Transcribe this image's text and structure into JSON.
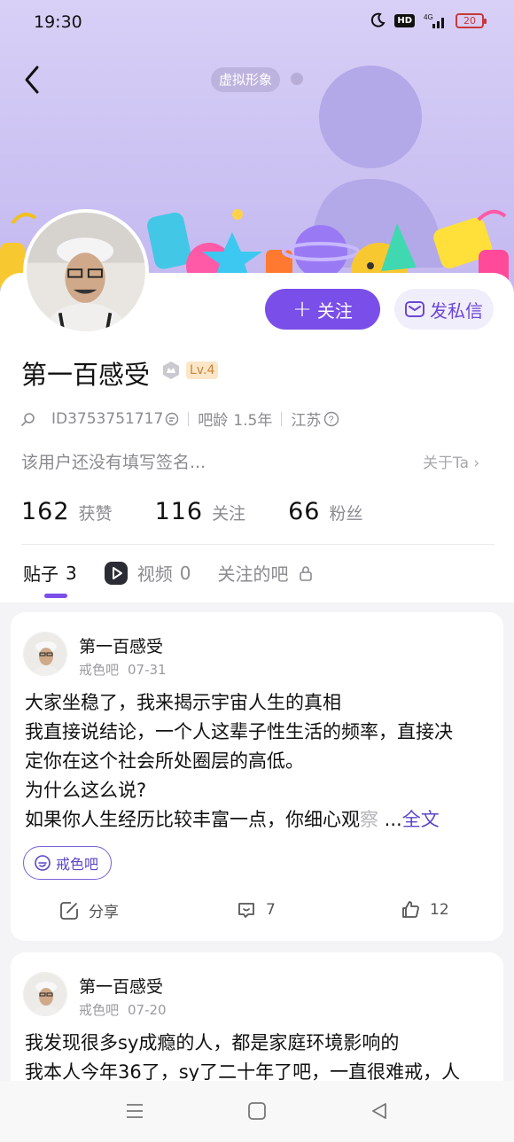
{
  "status_bar": {
    "time": "19:30",
    "hd_label": "HD",
    "network_label": "4G",
    "battery": "20"
  },
  "header": {
    "back_icon": "chevron-left-icon",
    "virtual_label": "虚拟形象"
  },
  "profile": {
    "name": "第一百感受",
    "level": "Lv.4",
    "id_label": "ID",
    "id_value": "3753751717",
    "age_label": "吧龄",
    "age_value": "1.5年",
    "location": "江苏",
    "bio": "该用户还没有填写签名...",
    "about_label": "关于Ta",
    "follow_label": "关注",
    "message_label": "发私信"
  },
  "stats": [
    {
      "value": "162",
      "label": "获赞"
    },
    {
      "value": "116",
      "label": "关注"
    },
    {
      "value": "66",
      "label": "粉丝"
    }
  ],
  "tabs": [
    {
      "label": "贴子",
      "count": "3"
    },
    {
      "label": "视频",
      "count": "0"
    },
    {
      "label": "关注的吧",
      "count": ""
    }
  ],
  "posts": [
    {
      "author": "第一百感受",
      "forum": "戒色吧",
      "date": "07-31",
      "lines": [
        "大家坐稳了，我来揭示宇宙人生的真相",
        "我直接说结论，一个人这辈子性生活的频率，直接决",
        "定你在这个社会所处圈层的高低。",
        "为什么这么说?"
      ],
      "last_line": "如果你人生经历比较丰富一点，你细心观",
      "last_line_fade": "察",
      "ellipsis": " ...",
      "fulltext_label": "全文",
      "tag": "戒色吧",
      "share_label": "分享",
      "comments": "7",
      "likes": "12"
    },
    {
      "author": "第一百感受",
      "forum": "戒色吧",
      "date": "07-20",
      "lines": [
        "我发现很多sy成瘾的人，都是家庭环境影响的",
        "我本人今年36了，sy了二十年了吧，一直很难戒，人"
      ]
    }
  ],
  "colors": {
    "accent": "#7a4ee8",
    "banner": "#cdc4f3",
    "muted": "#8a8a8f"
  }
}
